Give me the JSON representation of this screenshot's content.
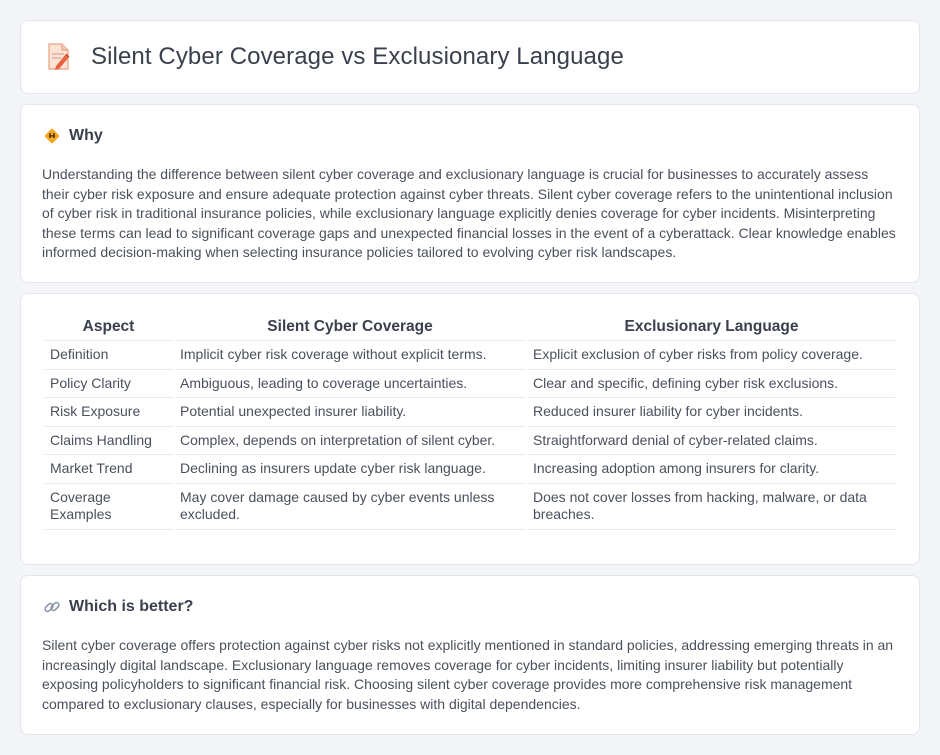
{
  "header": {
    "title": "Silent Cyber Coverage vs Exclusionary Language",
    "icon": "document-pencil-icon"
  },
  "why": {
    "title": "Why",
    "icon": "diamond-warning-icon",
    "text": "Understanding the difference between silent cyber coverage and exclusionary language is crucial for businesses to accurately assess their cyber risk exposure and ensure adequate protection against cyber threats. Silent cyber coverage refers to the unintentional inclusion of cyber risk in traditional insurance policies, while exclusionary language explicitly denies coverage for cyber incidents. Misinterpreting these terms can lead to significant coverage gaps and unexpected financial losses in the event of a cyberattack. Clear knowledge enables informed decision-making when selecting insurance policies tailored to evolving cyber risk landscapes."
  },
  "table": {
    "headers": [
      "Aspect",
      "Silent Cyber Coverage",
      "Exclusionary Language"
    ],
    "rows": [
      [
        "Definition",
        "Implicit cyber risk coverage without explicit terms.",
        "Explicit exclusion of cyber risks from policy coverage."
      ],
      [
        "Policy Clarity",
        "Ambiguous, leading to coverage uncertainties.",
        "Clear and specific, defining cyber risk exclusions."
      ],
      [
        "Risk Exposure",
        "Potential unexpected insurer liability.",
        "Reduced insurer liability for cyber incidents."
      ],
      [
        "Claims Handling",
        "Complex, depends on interpretation of silent cyber.",
        "Straightforward denial of cyber-related claims."
      ],
      [
        "Market Trend",
        "Declining as insurers update cyber risk language.",
        "Increasing adoption among insurers for clarity."
      ],
      [
        "Coverage Examples",
        "May cover damage caused by cyber events unless excluded.",
        "Does not cover losses from hacking, malware, or data breaches."
      ]
    ]
  },
  "better": {
    "title": "Which is better?",
    "icon": "link-icon",
    "text": "Silent cyber coverage offers protection against cyber risks not explicitly mentioned in standard policies, addressing emerging threats in an increasingly digital landscape. Exclusionary language removes coverage for cyber incidents, limiting insurer liability but potentially exposing policyholders to significant financial risk. Choosing silent cyber coverage provides more comprehensive risk management compared to exclusionary clauses, especially for businesses with digital dependencies."
  }
}
